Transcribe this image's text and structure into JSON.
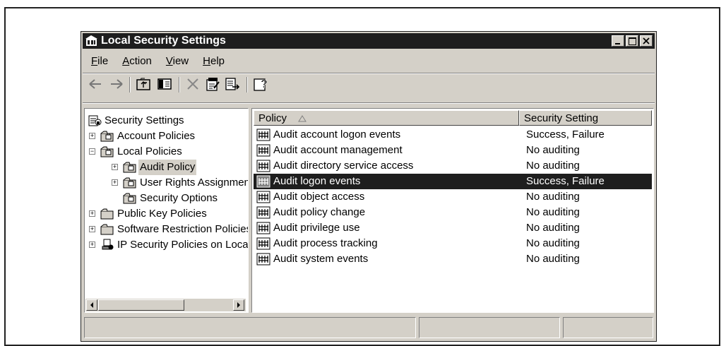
{
  "window": {
    "title": "Local Security Settings"
  },
  "menu": [
    {
      "label": "File",
      "u": "F",
      "rest": "ile"
    },
    {
      "label": "Action",
      "u": "A",
      "rest": "ction"
    },
    {
      "label": "View",
      "u": "V",
      "rest": "iew"
    },
    {
      "label": "Help",
      "u": "H",
      "rest": "elp"
    }
  ],
  "toolbar": [
    "back-icon",
    "forward-icon",
    "up-folder-icon",
    "show-hide-tree-icon",
    "delete-icon",
    "properties-icon",
    "export-list-icon",
    "help-icon"
  ],
  "tree": {
    "items": [
      {
        "label": "Security Settings"
      },
      {
        "label": "Account Policies"
      },
      {
        "label": "Local Policies"
      },
      {
        "label": "Audit Policy"
      },
      {
        "label": "User Rights Assignment"
      },
      {
        "label": "Security Options"
      },
      {
        "label": "Public Key Policies"
      },
      {
        "label": "Software Restriction Policies"
      },
      {
        "label": "IP Security Policies on Local Computer"
      }
    ]
  },
  "list": {
    "columns": {
      "policy": "Policy",
      "setting": "Security Setting"
    },
    "rows": [
      {
        "policy": "Audit account logon events",
        "setting": "Success, Failure"
      },
      {
        "policy": "Audit account management",
        "setting": "No auditing"
      },
      {
        "policy": "Audit directory service access",
        "setting": "No auditing"
      },
      {
        "policy": "Audit logon events",
        "setting": "Success, Failure"
      },
      {
        "policy": "Audit object access",
        "setting": "No auditing"
      },
      {
        "policy": "Audit policy change",
        "setting": "No auditing"
      },
      {
        "policy": "Audit privilege use",
        "setting": "No auditing"
      },
      {
        "policy": "Audit process tracking",
        "setting": "No auditing"
      },
      {
        "policy": "Audit system events",
        "setting": "No auditing"
      }
    ]
  }
}
